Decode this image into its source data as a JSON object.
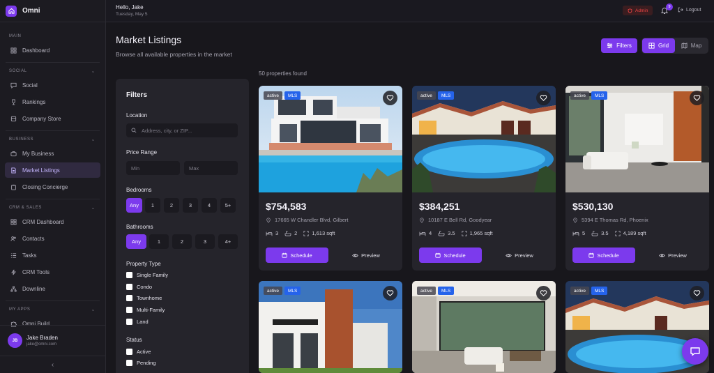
{
  "app": {
    "name": "Omni"
  },
  "sidebar": {
    "sections": [
      {
        "label": "MAIN",
        "items": [
          {
            "label": "Dashboard",
            "icon": "grid-icon"
          }
        ]
      },
      {
        "label": "SOCIAL",
        "items": [
          {
            "label": "Social",
            "icon": "message-icon"
          },
          {
            "label": "Rankings",
            "icon": "trophy-icon"
          },
          {
            "label": "Company Store",
            "icon": "store-icon"
          }
        ]
      },
      {
        "label": "BUSINESS",
        "items": [
          {
            "label": "My Business",
            "icon": "briefcase-icon"
          },
          {
            "label": "Market Listings",
            "icon": "document-icon",
            "active": true
          },
          {
            "label": "Closing Concierge",
            "icon": "clipboard-icon"
          }
        ]
      },
      {
        "label": "CRM & SALES",
        "items": [
          {
            "label": "CRM Dashboard",
            "icon": "grid-icon"
          },
          {
            "label": "Contacts",
            "icon": "users-icon"
          },
          {
            "label": "Tasks",
            "icon": "list-icon"
          },
          {
            "label": "CRM Tools",
            "icon": "bolt-icon"
          },
          {
            "label": "Downline",
            "icon": "tree-icon"
          }
        ]
      },
      {
        "label": "MY APPS",
        "items": [
          {
            "label": "Omni Build",
            "icon": "puzzle-icon"
          }
        ]
      }
    ],
    "user": {
      "initials": "JB",
      "name": "Jake Braden",
      "email": "jake@omni.com"
    }
  },
  "topbar": {
    "greeting": "Hello, Jake",
    "date": "Tuesday, May 5",
    "admin_label": "Admin",
    "notification_count": "9",
    "logout_label": "Logout"
  },
  "header": {
    "title": "Market Listings",
    "subtitle": "Browse all available properties in the market",
    "filters_button": "Filters",
    "view_grid": "Grid",
    "view_map": "Map",
    "result_count": "50 properties found"
  },
  "filters": {
    "title": "Filters",
    "location_label": "Location",
    "location_placeholder": "Address, city, or ZIP...",
    "price_label": "Price Range",
    "min_placeholder": "Min",
    "max_placeholder": "Max",
    "bedrooms_label": "Bedrooms",
    "bedroom_options": [
      "Any",
      "1",
      "2",
      "3",
      "4",
      "5+"
    ],
    "bathrooms_label": "Bathrooms",
    "bathroom_options": [
      "Any",
      "1",
      "2",
      "3",
      "4+"
    ],
    "property_type_label": "Property Type",
    "property_types": [
      "Single Family",
      "Condo",
      "Townhome",
      "Multi-Family",
      "Land"
    ],
    "status_label": "Status",
    "statuses": [
      "Active",
      "Pending"
    ]
  },
  "listings": [
    {
      "status": "active",
      "source": "MLS",
      "price": "$754,583",
      "address": "17665 W Chandler Blvd, Gilbert",
      "beds": "3",
      "baths": "2",
      "sqft": "1,613 sqft",
      "schedule": "Schedule",
      "preview": "Preview"
    },
    {
      "status": "active",
      "source": "MLS",
      "price": "$384,251",
      "address": "10187 E Bell Rd, Goodyear",
      "beds": "4",
      "baths": "3.5",
      "sqft": "1,965 sqft",
      "schedule": "Schedule",
      "preview": "Preview"
    },
    {
      "status": "active",
      "source": "MLS",
      "price": "$530,130",
      "address": "5394 E Thomas Rd, Phoenix",
      "beds": "5",
      "baths": "3.5",
      "sqft": "4,189 sqft",
      "schedule": "Schedule",
      "preview": "Preview"
    },
    {
      "status": "active",
      "source": "MLS"
    },
    {
      "status": "active",
      "source": "MLS"
    },
    {
      "status": "active",
      "source": "MLS"
    }
  ],
  "colors": {
    "accent": "#7c3aed",
    "mls_badge": "#2563eb",
    "admin": "#ef4444"
  }
}
